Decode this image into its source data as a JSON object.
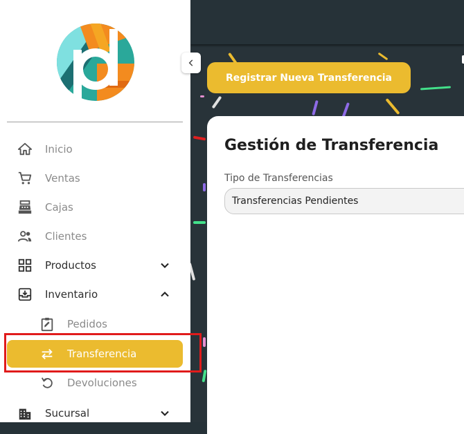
{
  "colors": {
    "accent": "#ebbb2f",
    "sidebar_bg": "#ffffff",
    "main_bg": "#283339",
    "highlight": "#e01b1b"
  },
  "sidebar": {
    "items": [
      {
        "label": "Inicio",
        "icon": "home-icon"
      },
      {
        "label": "Ventas",
        "icon": "cart-icon"
      },
      {
        "label": "Cajas",
        "icon": "cash-register-icon"
      },
      {
        "label": "Clientes",
        "icon": "clients-icon"
      },
      {
        "label": "Productos",
        "icon": "grid-icon",
        "expanded": false
      },
      {
        "label": "Inventario",
        "icon": "inventory-icon",
        "expanded": true
      },
      {
        "label": "Pedidos",
        "icon": "clipboard-edit-icon"
      },
      {
        "label": "Transferencia",
        "icon": "swap-arrows-icon",
        "active": true
      },
      {
        "label": "Devoluciones",
        "icon": "undo-icon"
      },
      {
        "label": "Sucursal",
        "icon": "building-icon",
        "expanded": false
      }
    ]
  },
  "main": {
    "register_button_label": "Registrar Nueva Transferencia",
    "card_title": "Gestión de Transferencia",
    "transfer_type": {
      "label": "Tipo de Transferencias",
      "value": "Transferencias Pendientes"
    }
  }
}
